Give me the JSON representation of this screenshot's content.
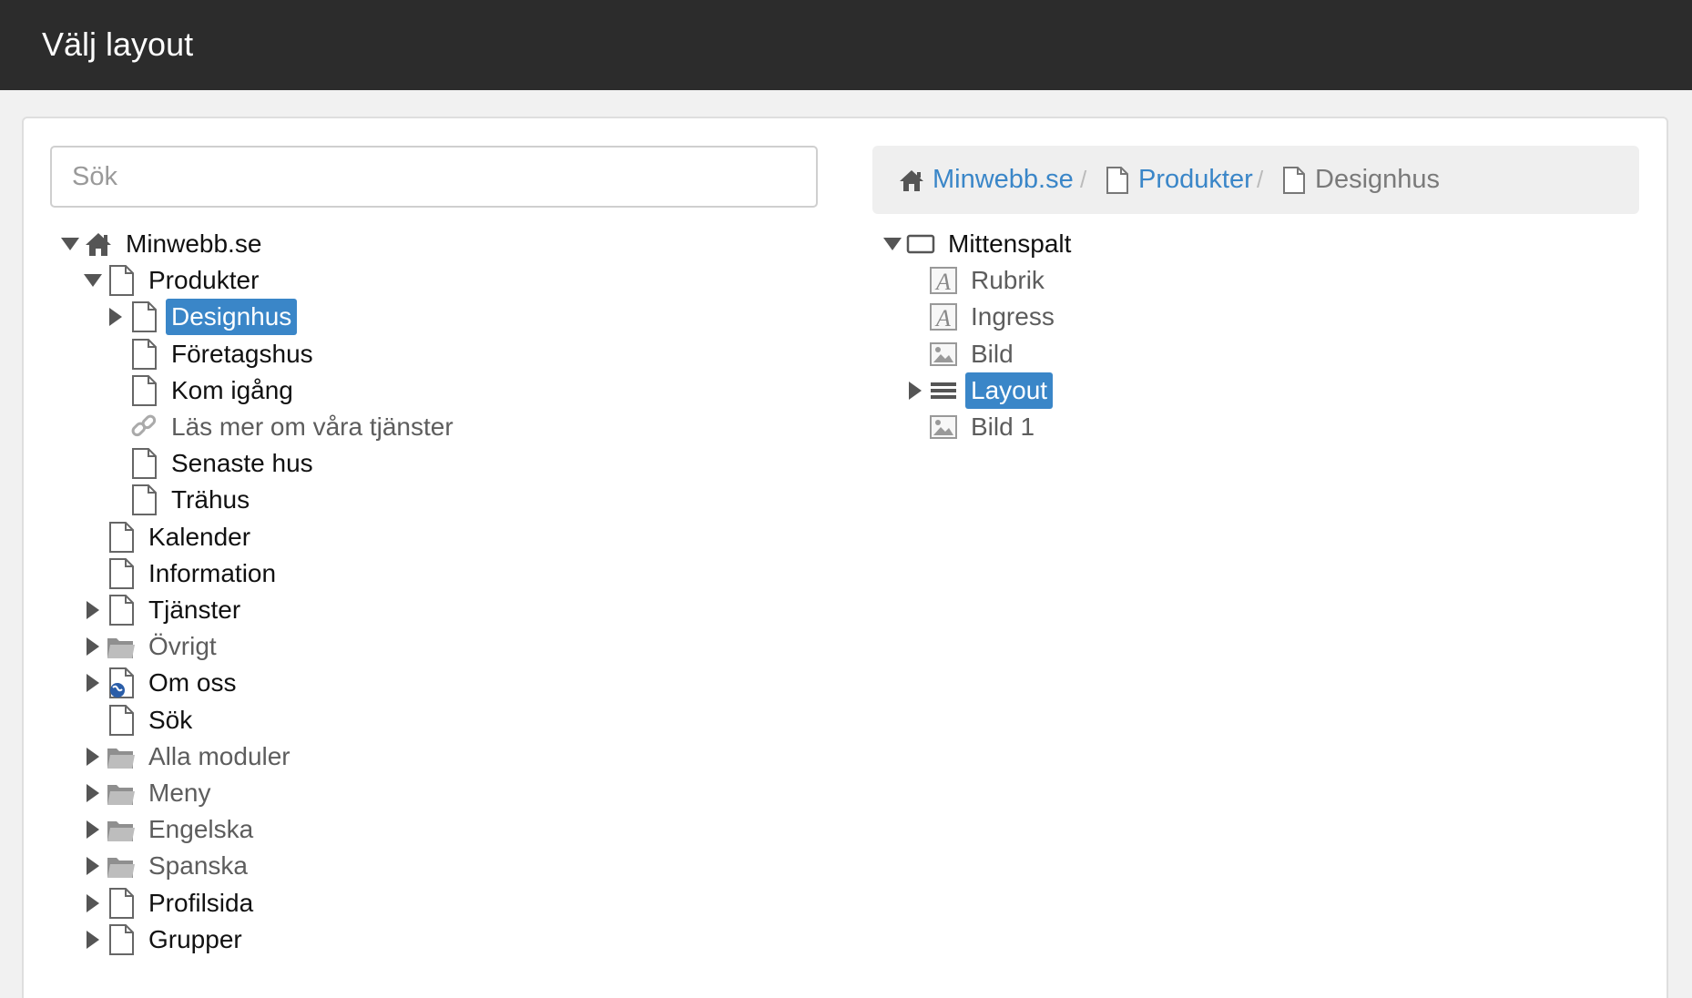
{
  "header": {
    "title": "Välj layout"
  },
  "search": {
    "placeholder": "Sök"
  },
  "breadcrumb": {
    "items": [
      "Minwebb.se",
      "Produkter",
      "Designhus"
    ],
    "separator": "/"
  },
  "left_tree": [
    {
      "label": "Minwebb.se",
      "icon": "home-icon",
      "twisty": "down"
    },
    {
      "label": "Produkter",
      "icon": "page-icon",
      "twisty": "down"
    },
    {
      "label": "Designhus",
      "icon": "page-icon",
      "twisty": "right",
      "selected": true
    },
    {
      "label": "Företagshus",
      "icon": "page-icon"
    },
    {
      "label": "Kom igång",
      "icon": "page-icon"
    },
    {
      "label": "Läs mer om våra tjänster",
      "icon": "link-icon"
    },
    {
      "label": "Senaste hus",
      "icon": "page-icon"
    },
    {
      "label": "Trähus",
      "icon": "page-icon"
    },
    {
      "label": "Kalender",
      "icon": "page-icon"
    },
    {
      "label": "Information",
      "icon": "page-icon"
    },
    {
      "label": "Tjänster",
      "icon": "page-icon",
      "twisty": "right"
    },
    {
      "label": "Övrigt",
      "icon": "folder-icon",
      "twisty": "right"
    },
    {
      "label": "Om oss",
      "icon": "globe-page-icon",
      "twisty": "right"
    },
    {
      "label": "Sök",
      "icon": "page-icon"
    },
    {
      "label": "Alla moduler",
      "icon": "folder-icon",
      "twisty": "right"
    },
    {
      "label": "Meny",
      "icon": "folder-icon",
      "twisty": "right"
    },
    {
      "label": "Engelska",
      "icon": "folder-icon",
      "twisty": "right"
    },
    {
      "label": "Spanska",
      "icon": "folder-icon",
      "twisty": "right"
    },
    {
      "label": "Profilsida",
      "icon": "page-icon",
      "twisty": "right"
    },
    {
      "label": "Grupper",
      "icon": "page-icon",
      "twisty": "right"
    }
  ],
  "right_tree": [
    {
      "label": "Mittenspalt",
      "icon": "frame-icon",
      "twisty": "down"
    },
    {
      "label": "Rubrik",
      "icon": "text-module-icon"
    },
    {
      "label": "Ingress",
      "icon": "text-module-icon"
    },
    {
      "label": "Bild",
      "icon": "image-module-icon"
    },
    {
      "label": "Layout",
      "icon": "layout-lines-icon",
      "twisty": "right",
      "selected": true
    },
    {
      "label": "Bild 1",
      "icon": "image-module-icon"
    }
  ],
  "colors": {
    "accent": "#3a86c8",
    "header_bg": "#2c2c2c"
  }
}
